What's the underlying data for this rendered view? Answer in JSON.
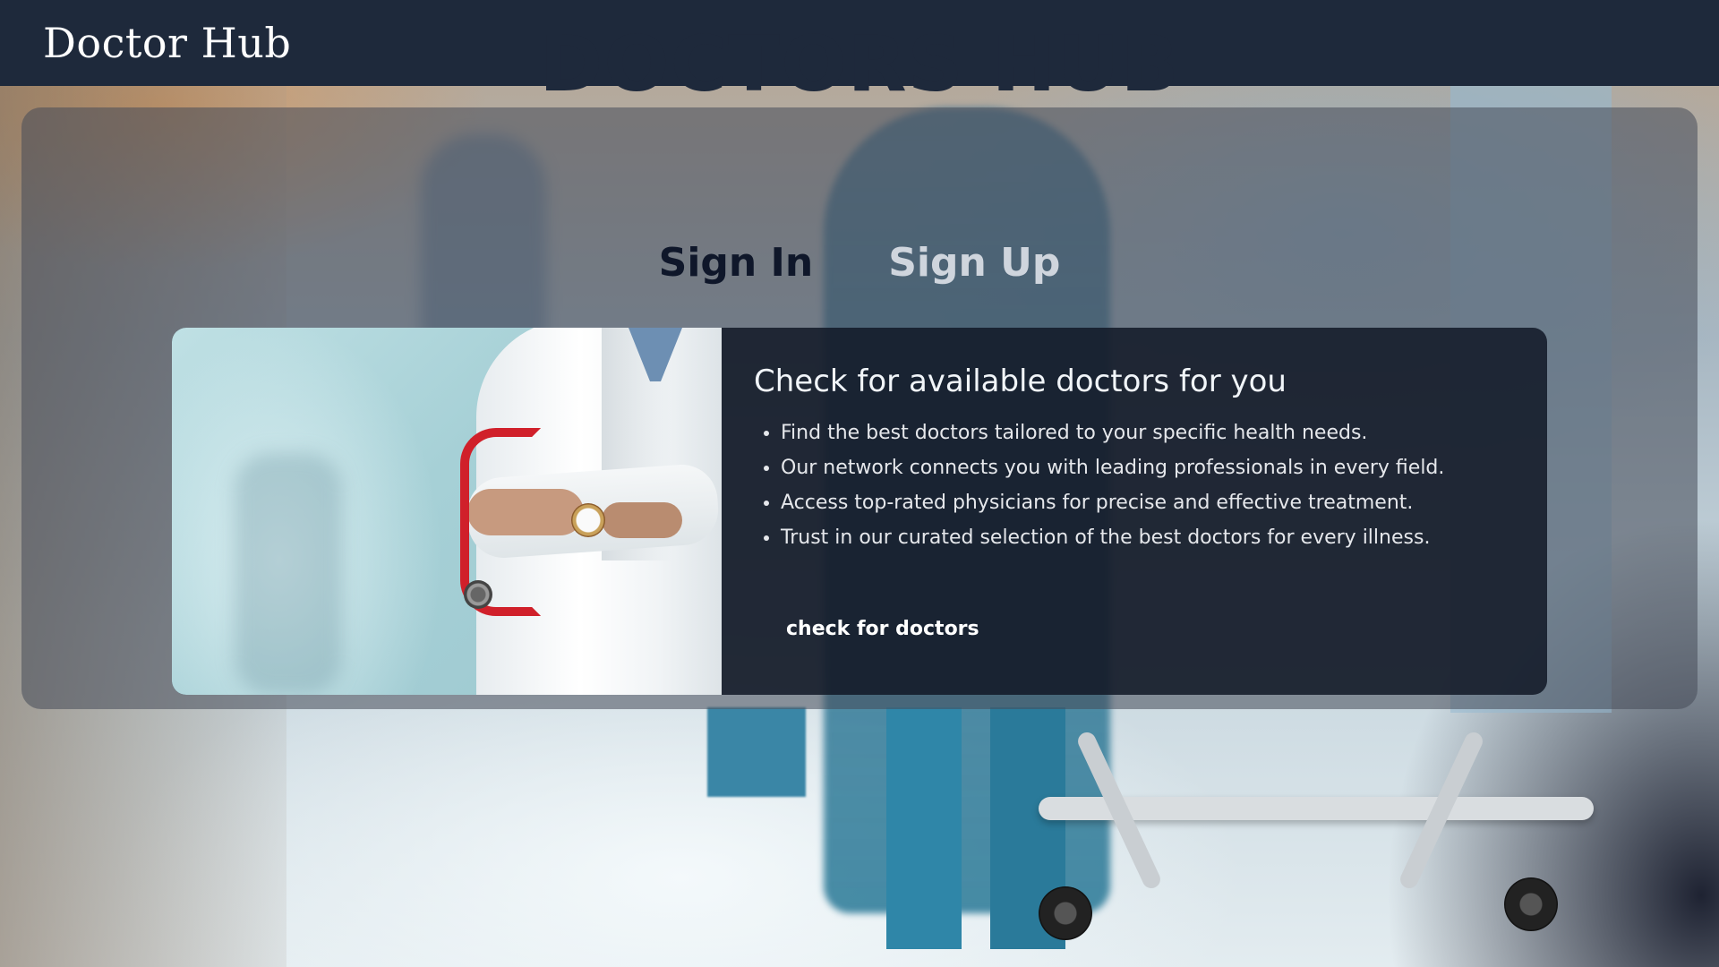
{
  "navbar": {
    "brand": "Doctor Hub"
  },
  "hero": {
    "title": "DOCTORS HUB"
  },
  "auth_tabs": [
    {
      "label": "Sign In",
      "active": true
    },
    {
      "label": "Sign Up",
      "active": false
    }
  ],
  "card": {
    "title": "Check for available doctors for you",
    "features": [
      "Find the best doctors tailored to your specific health needs.",
      "Our network connects you with leading professionals in every field.",
      "Access top-rated physicians for precise and effective treatment.",
      "Trust in our curated selection of the best doctors for every illness."
    ],
    "cta_label": "check for doctors"
  },
  "colors": {
    "navbar_bg": "#1e293b",
    "title_color": "#1e293b",
    "active_tab": "#0f172a",
    "inactive_tab": "#cfd5dd",
    "card_bg": "#111827"
  }
}
